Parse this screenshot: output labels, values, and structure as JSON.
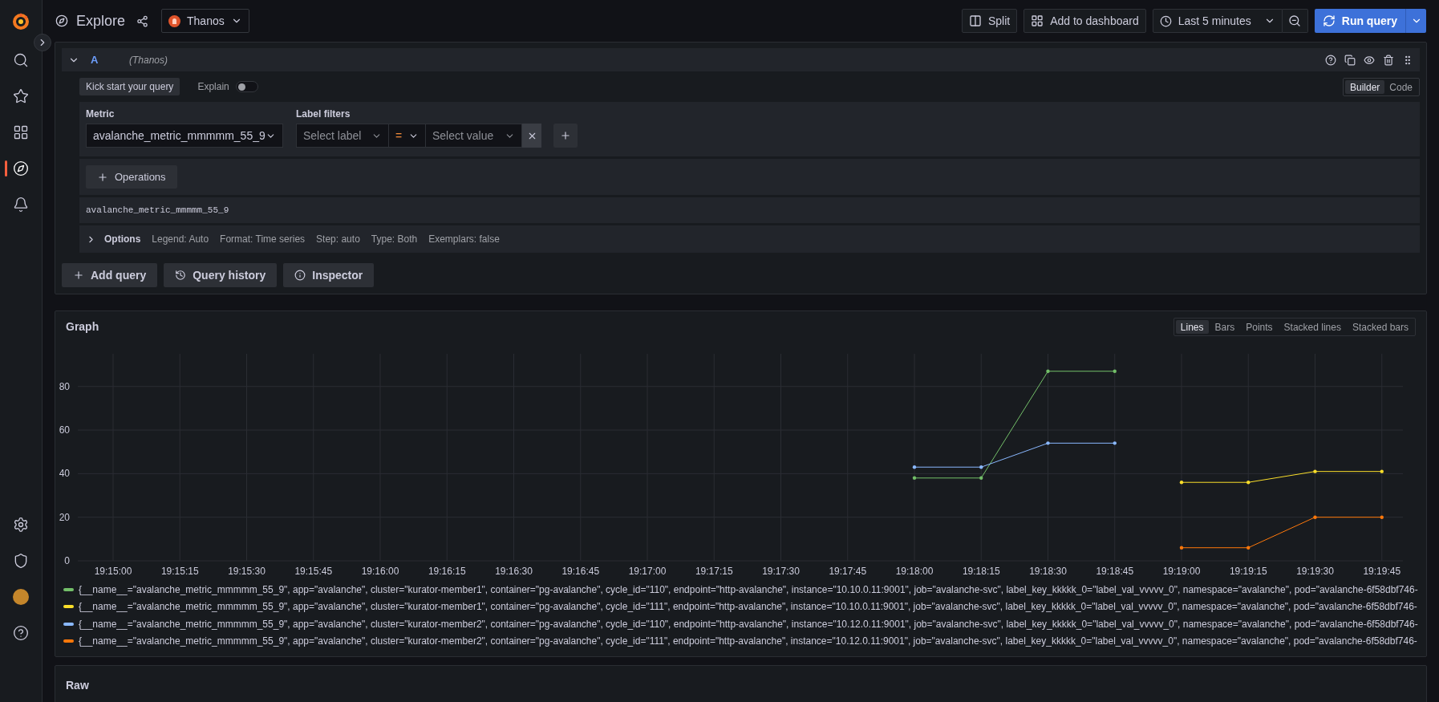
{
  "topbar": {
    "title": "Explore",
    "datasource": "Thanos",
    "buttons": [
      {
        "kind": "split",
        "label": "Split"
      },
      {
        "kind": "dashboard",
        "label": "Add to dashboard"
      }
    ],
    "time_range": "Last 5 minutes",
    "run_query": "Run query"
  },
  "sidebar": {
    "items": [
      {
        "selected": false
      },
      {
        "selected": false
      },
      {
        "selected": false
      },
      {
        "selected": true
      },
      {
        "selected": false
      }
    ],
    "bottom_items": [
      {
        "selected": false
      },
      {
        "selected": false
      },
      {
        "selected": false
      },
      {
        "selected": false
      }
    ]
  },
  "query": {
    "ref": "A",
    "datasource": "(Thanos)",
    "kick_start": "Kick start your query",
    "explain": {
      "label": "Explain",
      "on": false
    },
    "modes": [
      {
        "label": "Builder",
        "selected": true
      },
      {
        "label": "Code",
        "selected": false
      }
    ],
    "metric": {
      "label": "Metric",
      "value": "avalanche_metric_mmmmm_55_9"
    },
    "label_filters": {
      "label": "Label filters",
      "label_placeholder": "Select label",
      "operator": "=",
      "value_placeholder": "Select value"
    },
    "operations": "Operations",
    "preview": "avalanche_metric_mmmmm_55_9",
    "options": {
      "title": "Options",
      "items": [
        "Legend: Auto",
        "Format: Time series",
        "Step: auto",
        "Type: Both",
        "Exemplars: false"
      ]
    },
    "buttons": [
      {
        "kind": "add",
        "label": "Add query"
      },
      {
        "kind": "history",
        "label": "Query history"
      },
      {
        "kind": "inspector",
        "label": "Inspector"
      }
    ]
  },
  "graph": {
    "title": "Graph",
    "views": [
      {
        "label": "Lines",
        "selected": true
      },
      {
        "label": "Bars",
        "selected": false
      },
      {
        "label": "Points",
        "selected": false
      },
      {
        "label": "Stacked lines",
        "selected": false
      },
      {
        "label": "Stacked bars",
        "selected": false
      }
    ],
    "chart_data": {
      "type": "line",
      "grid": true,
      "categories": [
        "19:15:00",
        "19:15:15",
        "19:15:30",
        "19:15:45",
        "19:16:00",
        "19:16:15",
        "19:16:30",
        "19:16:45",
        "19:17:00",
        "19:17:15",
        "19:17:30",
        "19:17:45",
        "19:18:00",
        "19:18:15",
        "19:18:30",
        "19:18:45",
        "19:19:00",
        "19:19:15",
        "19:19:30",
        "19:19:45"
      ],
      "ylim": [
        0,
        95
      ],
      "yticks": [
        0,
        20,
        40,
        60,
        80
      ],
      "series": [
        {
          "name": "{__name__=\"avalanche_metric_mmmmm_55_9\", app=\"avalanche\", cluster=\"kurator-member1\", container=\"pg-avalanche\", cycle_id=\"110\", endpoint=\"http-avalanche\", instance=\"10.10.0.11:9001\", job=\"avalanche-svc\", label_key_kkkkk_0=\"label_val_vvvvv_0\", namespace=\"avalanche\", pod=\"avalanche-6f58dbf746-",
          "color": "#73bf69",
          "values": [
            null,
            null,
            null,
            null,
            null,
            null,
            null,
            null,
            null,
            null,
            null,
            null,
            38,
            38,
            87,
            87,
            null,
            null,
            null,
            null
          ]
        },
        {
          "name": "{__name__=\"avalanche_metric_mmmmm_55_9\", app=\"avalanche\", cluster=\"kurator-member1\", container=\"pg-avalanche\", cycle_id=\"111\", endpoint=\"http-avalanche\", instance=\"10.10.0.11:9001\", job=\"avalanche-svc\", label_key_kkkkk_0=\"label_val_vvvvv_0\", namespace=\"avalanche\", pod=\"avalanche-6f58dbf746-",
          "color": "#fade2a",
          "values": [
            null,
            null,
            null,
            null,
            null,
            null,
            null,
            null,
            null,
            null,
            null,
            null,
            null,
            null,
            null,
            null,
            36,
            36,
            41,
            41
          ]
        },
        {
          "name": "{__name__=\"avalanche_metric_mmmmm_55_9\", app=\"avalanche\", cluster=\"kurator-member2\", container=\"pg-avalanche\", cycle_id=\"110\", endpoint=\"http-avalanche\", instance=\"10.12.0.11:9001\", job=\"avalanche-svc\", label_key_kkkkk_0=\"label_val_vvvvv_0\", namespace=\"avalanche\", pod=\"avalanche-6f58dbf746-",
          "color": "#8ab8ff",
          "values": [
            null,
            null,
            null,
            null,
            null,
            null,
            null,
            null,
            null,
            null,
            null,
            null,
            43,
            43,
            54,
            54,
            null,
            null,
            null,
            null
          ]
        },
        {
          "name": "{__name__=\"avalanche_metric_mmmmm_55_9\", app=\"avalanche\", cluster=\"kurator-member2\", container=\"pg-avalanche\", cycle_id=\"111\", endpoint=\"http-avalanche\", instance=\"10.12.0.11:9001\", job=\"avalanche-svc\", label_key_kkkkk_0=\"label_val_vvvvv_0\", namespace=\"avalanche\", pod=\"avalanche-6f58dbf746-",
          "color": "#ff780a",
          "values": [
            null,
            null,
            null,
            null,
            null,
            null,
            null,
            null,
            null,
            null,
            null,
            null,
            null,
            null,
            null,
            null,
            6,
            6,
            20,
            20
          ]
        }
      ]
    }
  },
  "raw": {
    "title": "Raw"
  }
}
